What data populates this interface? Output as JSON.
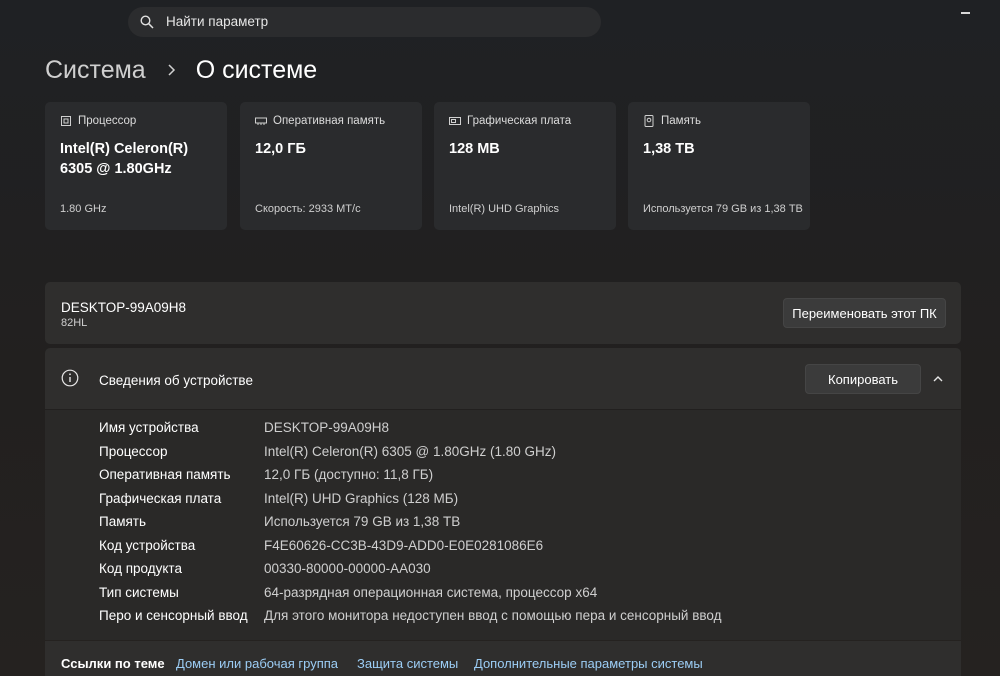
{
  "search": {
    "placeholder": "Найти параметр",
    "icon": "search-icon"
  },
  "breadcrumb": {
    "root": "Система",
    "separator_icon": "chevron-right-icon",
    "current": "О системе"
  },
  "cards": [
    {
      "icon": "processor-icon",
      "label": "Процессор",
      "value": "Intel(R) Celeron(R) 6305 @ 1.80GHz",
      "sub": "1.80 GHz"
    },
    {
      "icon": "memory-icon",
      "label": "Оперативная память",
      "value": "12,0 ГБ",
      "sub": "Скорость: 2933 MT/с"
    },
    {
      "icon": "graphics-card-icon",
      "label": "Графическая плата",
      "value": "128 MB",
      "sub": "Intel(R) UHD Graphics"
    },
    {
      "icon": "storage-icon",
      "label": "Память",
      "value": "1,38 TB",
      "sub": "Используется 79 GB из 1,38 TB"
    }
  ],
  "device": {
    "name": "DESKTOP-99A09H8",
    "model": "82HL",
    "rename_label": "Переименовать этот ПК"
  },
  "specs": {
    "icon": "info-icon",
    "title": "Сведения об устройстве",
    "copy_label": "Копировать",
    "rows": [
      {
        "key": "Имя устройства",
        "value": "DESKTOP-99A09H8"
      },
      {
        "key": "Процессор",
        "value": "Intel(R) Celeron(R) 6305 @ 1.80GHz (1.80 GHz)"
      },
      {
        "key": "Оперативная память",
        "value": "12,0 ГБ (доступно: 11,8 ГБ)"
      },
      {
        "key": "Графическая плата",
        "value": "Intel(R) UHD Graphics (128 МБ)"
      },
      {
        "key": "Память",
        "value": "Используется 79 GB из 1,38 TB"
      },
      {
        "key": "Код устройства",
        "value": "F4E60626-CC3B-43D9-ADD0-E0E0281086E6"
      },
      {
        "key": "Код продукта",
        "value": "00330-80000-00000-AA030"
      },
      {
        "key": "Тип системы",
        "value": "64-разрядная операционная система, процессор x64"
      },
      {
        "key": "Перо и сенсорный ввод",
        "value": "Для этого монитора недоступен ввод с помощью пера и сенсорный ввод"
      }
    ]
  },
  "related": {
    "label": "Ссылки по теме",
    "links": [
      "Домен или рабочая группа",
      "Защита системы",
      "Дополнительные параметры системы"
    ]
  },
  "colors": {
    "link": "#9ccdf5",
    "card_bg": "#2a2b2d",
    "panel_bg": "#2f2e2d"
  }
}
